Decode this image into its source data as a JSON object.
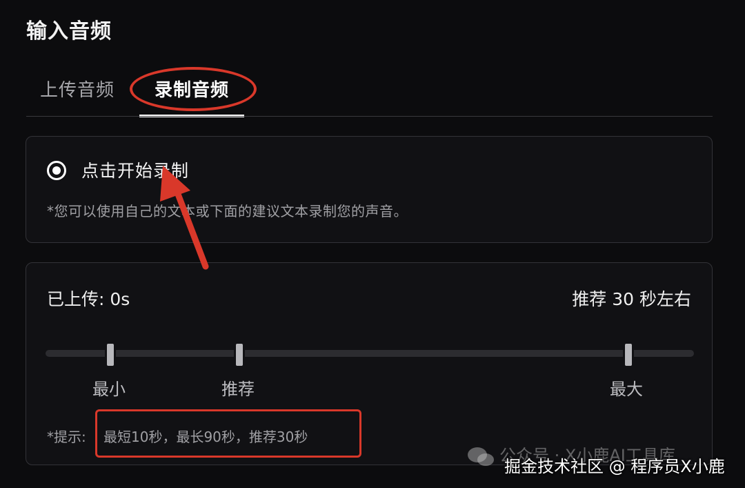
{
  "section": {
    "title": "输入音频"
  },
  "tabs": [
    {
      "label": "上传音频",
      "active": false
    },
    {
      "label": "录制音频",
      "active": true
    }
  ],
  "record": {
    "option_label": "点击开始录制",
    "option_selected": true,
    "hint": "*您可以使用自己的文本或下面的建议文本录制您的声音。"
  },
  "progress": {
    "uploaded": "已上传: 0s",
    "recommend": "推荐 30 秒左右",
    "markers": [
      {
        "label": "最小"
      },
      {
        "label": "推荐"
      },
      {
        "label": "最大"
      }
    ],
    "tip_prefix": "*提示:",
    "tip_text": "最短10秒，最长90秒，推荐30秒"
  },
  "watermarks": {
    "line1": "公众号 · X小鹿AI工具库",
    "line2": "掘金技术社区 @ 程序员X小鹿"
  },
  "colors": {
    "background": "#0c0c0e",
    "annotation": "#d9382a",
    "card_border": "#333338"
  },
  "icons": [
    "radio-selected-icon",
    "annotation-arrow-icon",
    "wechat-icon"
  ]
}
